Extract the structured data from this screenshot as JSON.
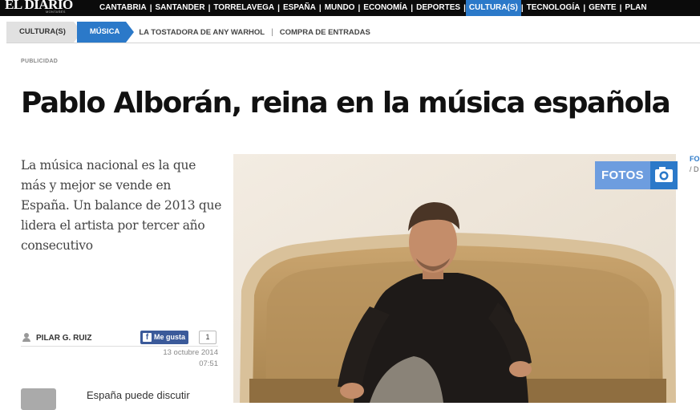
{
  "header": {
    "logo": "EL DIARIO",
    "logo_sub": "MONTAÑÉS",
    "nav": [
      {
        "label": "CANTABRIA",
        "active": false
      },
      {
        "label": "SANTANDER",
        "active": false
      },
      {
        "label": "TORRELAVEGA",
        "active": false
      },
      {
        "label": "ESPAÑA",
        "active": false
      },
      {
        "label": "MUNDO",
        "active": false
      },
      {
        "label": "ECONOMÍA",
        "active": false
      },
      {
        "label": "DEPORTES",
        "active": false
      },
      {
        "label": "CULTURA(S)",
        "active": true
      },
      {
        "label": "TECNOLOGÍA",
        "active": false
      },
      {
        "label": "GENTE",
        "active": false
      },
      {
        "label": "PLAN",
        "active": false
      }
    ],
    "nav_separator": "|"
  },
  "breadcrumb": {
    "section": "CULTURA(S)",
    "current": "MÚSICA",
    "links": [
      "LA TOSTADORA DE ANY WARHOL",
      "COMPRA DE ENTRADAS"
    ],
    "separator": "|"
  },
  "ad_label": "PUBLICIDAD",
  "article": {
    "headline": "Pablo Alborán, reina en la música española",
    "subtitle": "La música nacional es la que más y mejor se vende en España. Un balance de 2013 que lidera el artista por tercer año consecutivo",
    "author": "PILAR G. RUIZ",
    "like_label": "Me gusta",
    "like_count": "1",
    "date": "13 octubre 2014",
    "time": "07:51",
    "body_start": "España puede discutir",
    "gallery_label": "FOTOS",
    "side_label_1": "FO",
    "side_label_2": "/ D"
  },
  "colors": {
    "accent": "#2b79c9",
    "topbar": "#0b0b0b",
    "facebook": "#3b5a9a"
  }
}
